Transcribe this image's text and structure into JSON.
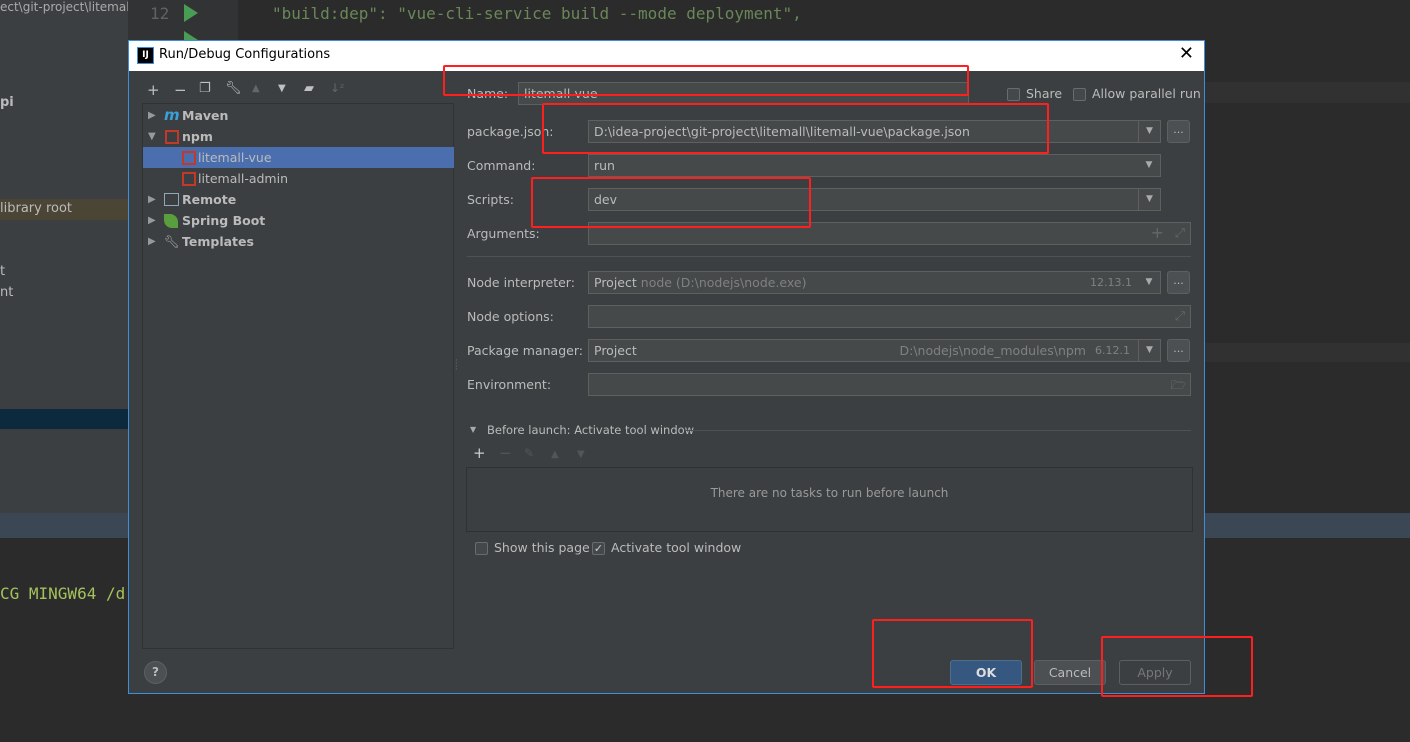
{
  "background": {
    "project_path_fragment": "ect\\git-project\\litemall",
    "sidebar_fragments": [
      "pi",
      "library root",
      "t",
      "nt"
    ],
    "line_number": "12",
    "code_line": "\"build:dep\": \"vue-cli-service build --mode deployment\",",
    "terminal_fragment": "CG MINGW64 /d"
  },
  "dialog": {
    "title": "Run/Debug Configurations",
    "app_icon_text": "IJ",
    "tree": {
      "groups": [
        {
          "label": "Maven",
          "expanded": false
        },
        {
          "label": "npm",
          "expanded": true,
          "children": [
            "litemall-vue",
            "litemall-admin"
          ]
        },
        {
          "label": "Remote",
          "expanded": false
        },
        {
          "label": "Spring Boot",
          "expanded": false
        },
        {
          "label": "Templates",
          "expanded": false
        }
      ],
      "selected": "litemall-vue"
    },
    "form": {
      "name_label": "Name:",
      "name_value": "litemall-vue",
      "share_label": "Share",
      "share_checked": false,
      "parallel_label": "Allow parallel run",
      "parallel_checked": false,
      "package_label": "package.json:",
      "package_value": "D:\\idea-project\\git-project\\litemall\\litemall-vue\\package.json",
      "command_label": "Command:",
      "command_value": "run",
      "scripts_label": "Scripts:",
      "scripts_value": "dev",
      "arguments_label": "Arguments:",
      "arguments_value": "",
      "node_label": "Node interpreter:",
      "node_value": "Project",
      "node_path": "node (D:\\nodejs\\node.exe)",
      "node_version": "12.13.1",
      "node_options_label": "Node options:",
      "node_options_value": "",
      "pm_label": "Package manager:",
      "pm_value": "Project",
      "pm_path": "D:\\nodejs\\node_modules\\npm",
      "pm_version": "6.12.1",
      "env_label": "Environment:",
      "env_value": "",
      "ellipsis": "..."
    },
    "before_launch": {
      "title": "Before launch: Activate tool window",
      "empty_text": "There are no tasks to run before launch",
      "show_page_label": "Show this page",
      "show_page_checked": false,
      "activate_label": "Activate tool window",
      "activate_checked": true
    },
    "buttons": {
      "ok": "OK",
      "cancel": "Cancel",
      "apply": "Apply",
      "help": "?"
    }
  },
  "colors": {
    "selection": "#4b6eaf",
    "accent": "#3d8fdb",
    "annotation": "#ff1f1f",
    "npm": "#c0392b"
  }
}
